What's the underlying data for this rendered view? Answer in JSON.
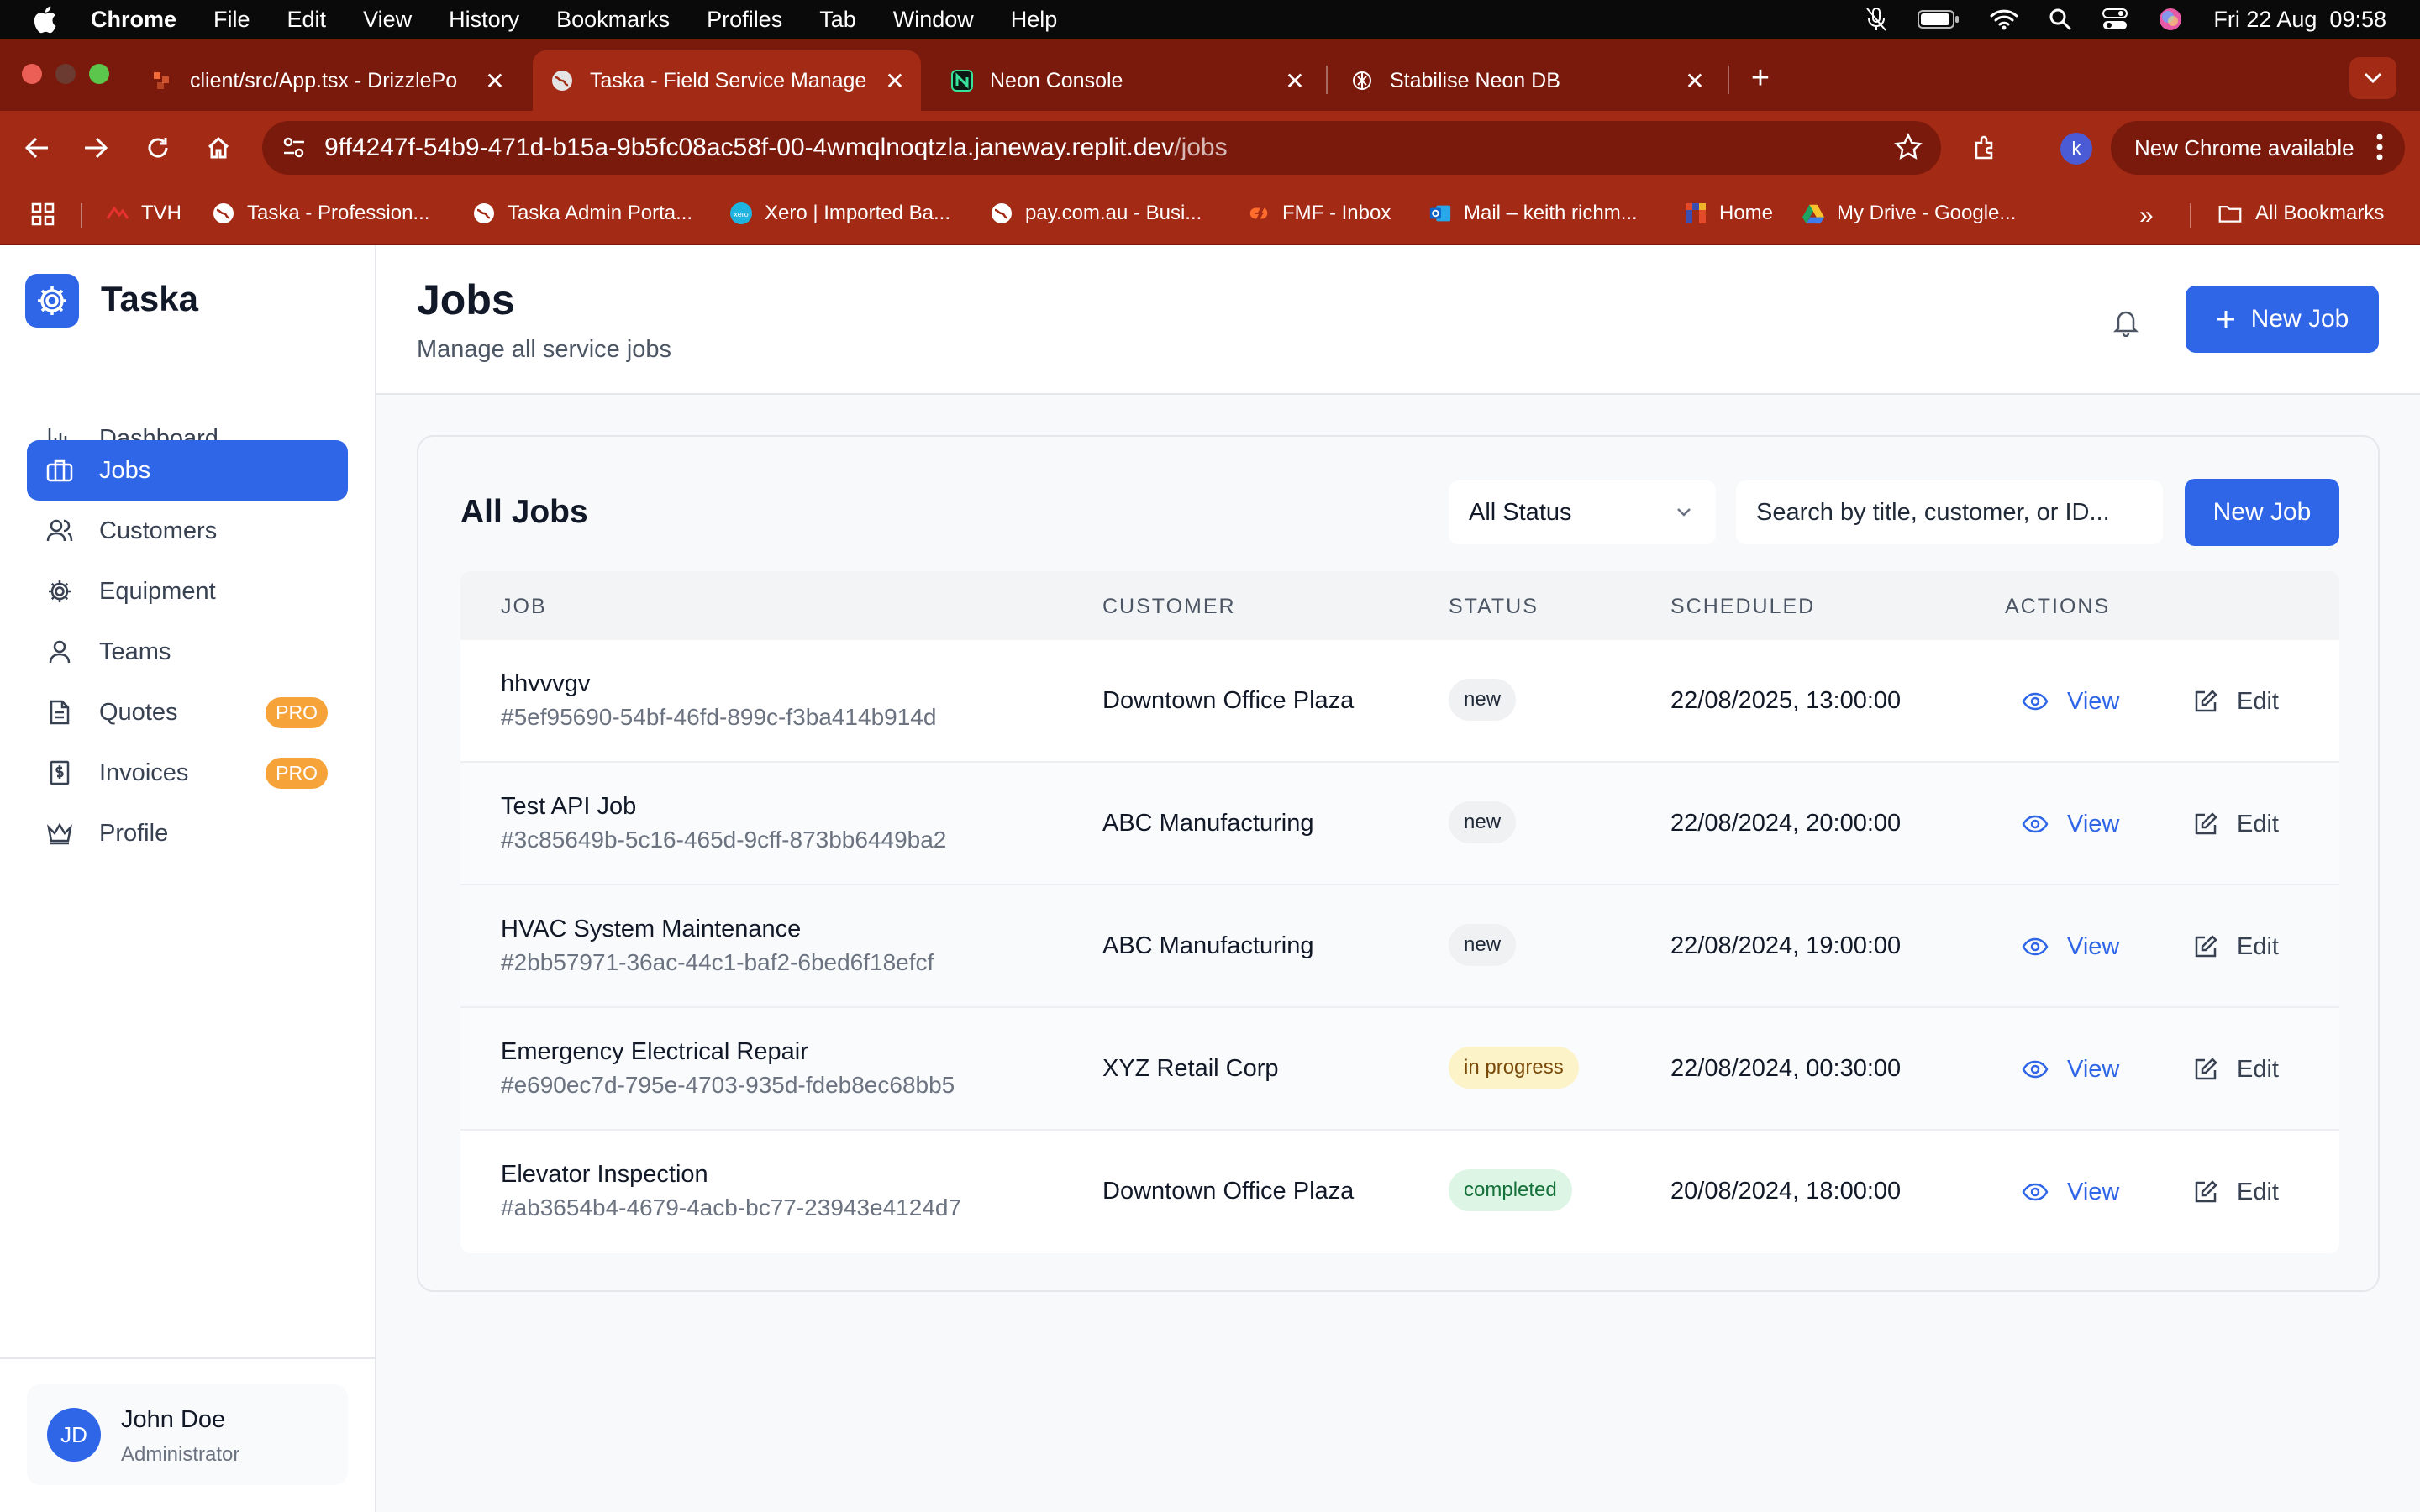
{
  "menubar": {
    "items": [
      "Chrome",
      "File",
      "Edit",
      "View",
      "History",
      "Bookmarks",
      "Profiles",
      "Tab",
      "Window",
      "Help"
    ],
    "datetime": "Fri 22 Aug  09:58"
  },
  "tabs": [
    {
      "label": "client/src/App.tsx - DrizzlePo",
      "icon": "code-icon"
    },
    {
      "label": "Taska - Field Service Manage",
      "icon": "globe-icon"
    },
    {
      "label": "Neon Console",
      "icon": "neon-icon"
    },
    {
      "label": "Stabilise Neon DB",
      "icon": "openai-icon"
    }
  ],
  "toolbar": {
    "url_host": "9ff4247f-54b9-471d-b15a-9b5fc08ac58f-00-4wmqlnoqtzla.janeway.replit.dev",
    "url_path": "/jobs",
    "new_chrome_label": "New Chrome available",
    "profile_initial": "k"
  },
  "bookmarks": {
    "items": [
      "TVH",
      "Taska - Profession...",
      "Taska Admin Porta...",
      "Xero | Imported Ba...",
      "pay.com.au - Busi...",
      "FMF - Inbox",
      "Mail – keith richm...",
      "Home",
      "My Drive - Google..."
    ],
    "all_label": "All Bookmarks"
  },
  "sidebar": {
    "brand": "Taska",
    "items": [
      {
        "label": "Dashboard",
        "icon": "bar-chart-icon"
      },
      {
        "label": "Jobs",
        "icon": "briefcase-icon"
      },
      {
        "label": "Customers",
        "icon": "users-icon"
      },
      {
        "label": "Equipment",
        "icon": "gear-icon"
      },
      {
        "label": "Teams",
        "icon": "user-icon"
      },
      {
        "label": "Quotes",
        "icon": "document-icon",
        "badge": "PRO"
      },
      {
        "label": "Invoices",
        "icon": "receipt-icon",
        "badge": "PRO"
      },
      {
        "label": "Profile",
        "icon": "crown-icon"
      }
    ],
    "user": {
      "initials": "JD",
      "name": "John Doe",
      "role": "Administrator"
    }
  },
  "header": {
    "title": "Jobs",
    "subtitle": "Manage all service jobs",
    "new_job_label": "New Job"
  },
  "card": {
    "title": "All Jobs",
    "status_filter": "All Status",
    "search_placeholder": "Search by title, customer, or ID...",
    "new_job_label": "New Job",
    "columns": [
      "JOB",
      "CUSTOMER",
      "STATUS",
      "SCHEDULED",
      "ACTIONS"
    ],
    "view_label": "View",
    "edit_label": "Edit",
    "rows": [
      {
        "title": "hhvvvgv",
        "id": "#5ef95690-54bf-46fd-899c-f3ba414b914d",
        "customer": "Downtown Office Plaza",
        "status": "new",
        "scheduled": "22/08/2025, 13:00:00"
      },
      {
        "title": "Test API Job",
        "id": "#3c85649b-5c16-465d-9cff-873bb6449ba2",
        "customer": "ABC Manufacturing",
        "status": "new",
        "scheduled": "22/08/2024, 20:00:00"
      },
      {
        "title": "HVAC System Maintenance",
        "id": "#2bb57971-36ac-44c1-baf2-6bed6f18efcf",
        "customer": "ABC Manufacturing",
        "status": "new",
        "scheduled": "22/08/2024, 19:00:00"
      },
      {
        "title": "Emergency Electrical Repair",
        "id": "#e690ec7d-795e-4703-935d-fdeb8ec68bb5",
        "customer": "XYZ Retail Corp",
        "status": "in progress",
        "scheduled": "22/08/2024, 00:30:00"
      },
      {
        "title": "Elevator Inspection",
        "id": "#ab3654b4-4679-4acb-bc77-23943e4124d7",
        "customer": "Downtown Office Plaza",
        "status": "completed",
        "scheduled": "20/08/2024, 18:00:00"
      }
    ]
  },
  "colors": {
    "accent": "#2f66e8",
    "chrome_frame": "#a32a15",
    "pro_badge": "#f6a33a"
  }
}
